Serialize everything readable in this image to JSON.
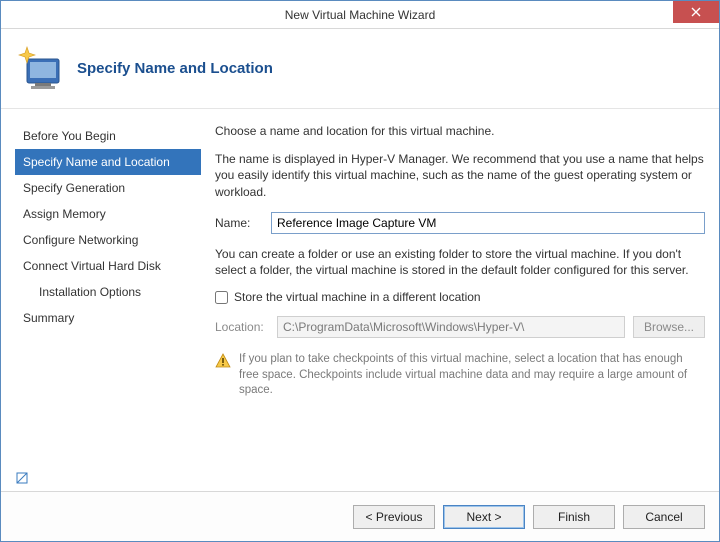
{
  "window": {
    "title": "New Virtual Machine Wizard"
  },
  "header": {
    "title": "Specify Name and Location"
  },
  "sidebar": {
    "items": [
      {
        "label": "Before You Begin"
      },
      {
        "label": "Specify Name and Location"
      },
      {
        "label": "Specify Generation"
      },
      {
        "label": "Assign Memory"
      },
      {
        "label": "Configure Networking"
      },
      {
        "label": "Connect Virtual Hard Disk"
      },
      {
        "label": "Installation Options"
      },
      {
        "label": "Summary"
      }
    ],
    "selected_index": 1
  },
  "content": {
    "intro": "Choose a name and location for this virtual machine.",
    "name_hint": "The name is displayed in Hyper-V Manager. We recommend that you use a name that helps you easily identify this virtual machine, such as the name of the guest operating system or workload.",
    "name_label": "Name:",
    "name_value": "Reference Image Capture VM",
    "folder_hint": "You can create a folder or use an existing folder to store the virtual machine. If you don't select a folder, the virtual machine is stored in the default folder configured for this server.",
    "store_checkbox_label": "Store the virtual machine in a different location",
    "store_checked": false,
    "location_label": "Location:",
    "location_value": "C:\\ProgramData\\Microsoft\\Windows\\Hyper-V\\",
    "browse_label": "Browse...",
    "warning_text": "If you plan to take checkpoints of this virtual machine, select a location that has enough free space. Checkpoints include virtual machine data and may require a large amount of space."
  },
  "footer": {
    "previous": "< Previous",
    "next": "Next >",
    "finish": "Finish",
    "cancel": "Cancel"
  }
}
